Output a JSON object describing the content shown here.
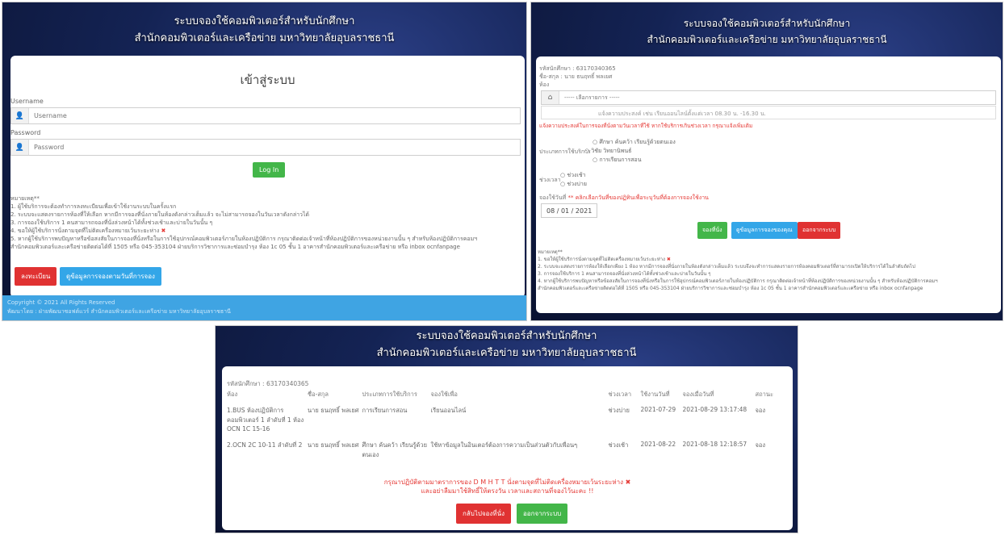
{
  "header": {
    "line1": "ระบบจองใช้คอมพิวเตอร์สำหรับนักศึกษา",
    "line2": "สำนักคอมพิวเตอร์และเครือข่าย มหาวิทยาลัยอุบลราชธานี"
  },
  "login": {
    "title": "เข้าสู่ระบบ",
    "username_label": "Username",
    "username_placeholder": "Username",
    "password_label": "Password",
    "password_placeholder": "Password",
    "login_button": "Log In",
    "notes_title": "หมายเหตุ**",
    "notes": [
      "1. ผู้ใช้บริการจะต้องทำการลงทะเบียนเพื่อเข้าใช้งานระบบในครั้งแรก",
      "2. ระบบจะแสดงรายการห้องที่ให้เลือก หากมีการจองที่นั่งภายในห้องดังกล่าวเต็มแล้ว จะไม่สามารถจองในวันเวลาดังกล่าวได้",
      "3. การจองใช้บริการ 1 คนสามารถจองที่นั่งล่วงหน้าได้ทั้งช่วงเช้าและบ่ายในวันนั้น ๆ",
      "4. ขอให้ผู้ใช้บริการนั่งตามจุดที่ไม่ติดเครื่องหมายเว้นระยะห่าง",
      "5. หากผู้ใช้บริการพบปัญหาหรือข้อสงสัยในการจองที่นั่งหรือในการใช้อุปกรณ์คอมพิวเตอร์ภายในห้องปฏิบัติการ กรุณาติดต่อเจ้าหน้าที่ห้องปฏิบัติการของหน่วยงานนั้น ๆ สำหรับห้องปฏิบัติการคอมฯ",
      "สำนักคอมพิวเตอร์และเครือข่ายติดต่อได้ที่ 1505 หรือ 045-353104 ฝ่ายบริการวิชาการและซ่อมบำรุง ห้อง 1c 05 ชั้น 1 อาคารสำนักคอมพิวเตอร์และเครือข่าย หรือ inbox ocnfanpage"
    ],
    "register_button": "ลงทะเบียน",
    "view_booking_button": "ดูข้อมูลการจองตามวันที่การจอง",
    "footer_copyright": "Copyright © 2021 All Rights Reserved",
    "footer_dev": "พัฒนาโดย : ฝ่ายพัฒนาซอฟต์แวร์ สำนักคอมพิวเตอร์และเครือข่าย มหาวิทยาลัยอุบลราชธานี"
  },
  "booking_form": {
    "student_id": "รหัสนักศึกษา : 63170340365",
    "name": "ชื่อ-สกุล : นาย ธนฤทธิ์ พลเยศ",
    "room_label": "ห้อง",
    "room_select": "----- เลือกรายการ -----",
    "purpose_placeholder": "แจ้งความประสงค์ เช่น เรียนออนไลน์ตั้งแต่เวลา 08.30 น. -16.30 น.",
    "purpose_warning": "แจ้งความประสงค์ในการจองที่นั่งตามวันเวลาที่ใช้ หากใช้บริการเกินช่วงเวลา กรุณาแจ้งเพิ่มเติม",
    "service_type_label": "ประเภทการใช้บริการ",
    "service_types": [
      "ศึกษา ค้นคว้า เรียนรู้ด้วยตนเอง",
      "วิชัย วิทยานิพนธ์",
      "การเรียนการสอน"
    ],
    "time_label": "ช่วงเวลา",
    "times": [
      "ช่วงเช้า",
      "ช่วงบ่าย"
    ],
    "date_label": "จองใช้วันที่",
    "date_hint": "** คลิกเลือกวันที่ของปฏิทินเพื่อระบุวันที่ต้องการจองใช้งาน",
    "date_value": "08 / 01 / 2021",
    "submit_button": "จองที่นั่ง",
    "my_booking_button": "ดูข้อมูลการจองของคุณ",
    "logout_button": "ออกจากระบบ",
    "notes_title": "หมายเหตุ**",
    "notes": [
      "1. ขอให้ผู้ใช้บริการนั่งตามจุดที่ไม่ติดเครื่องหมายเว้นระยะห่าง",
      "2. ระบบจะแสดงรายการห้องให้เลือกเพียง 1 ห้อง หากมีการจองที่นั่งภายในห้องดังกล่าวเต็มแล้ว ระบบจึงจะทำการแสดงรายการห้องคอมพิวเตอร์ที่สามารถเปิดให้บริการได้ในลำดับถัดไป",
      "3. การจองใช้บริการ 1 คนสามารถจองที่นั่งล่วงหน้าได้ทั้งช่วงเช้าและบ่ายในวันนั้น ๆ",
      "4. หากผู้ใช้บริการพบปัญหาหรือข้อสงสัยในการจองที่นั่งหรือในการใช้อุปกรณ์คอมพิวเตอร์ภายในห้องปฏิบัติการ กรุณาติดต่อเจ้าหน้าที่ห้องปฏิบัติการของหน่วยงานนั้น ๆ สำหรับห้องปฏิบัติการคอมฯ",
      "สำนักคอมพิวเตอร์และเครือข่ายติดต่อได้ที่ 1505 หรือ 045-353104 ฝ่ายบริการวิชาการและซ่อมบำรุง ห้อง 1c 05 ชั้น 1 อาคารสำนักคอมพิวเตอร์และเครือข่าย หรือ inbox ocnfanpage"
    ]
  },
  "booking_list": {
    "student_id": "รหัสนักศึกษา : 63170340365",
    "columns": [
      "ห้อง",
      "ชื่อ-สกุล",
      "ประเภทการใช้บริการ",
      "จองใช้เพื่อ",
      "ช่วงเวลา",
      "ใช้งานวันที่",
      "จองเมื่อวันที่",
      "สถานะ"
    ],
    "rows": [
      [
        "1.BUS ห้องปฏิบัติการคอมพิวเตอร์ 1 ลำดับที่ 1 ห้อง OCN 1C 15-16",
        "นาย ธนฤทธิ์ พลเยศ",
        "การเรียนการสอน",
        "เรียนออนไลน์",
        "ช่วงบ่าย",
        "2021-07-29",
        "2021-08-29 13:17:48",
        "จอง"
      ],
      [
        "2.OCN 2C 10-11 ลำดับที่ 2",
        "นาย ธนฤทธิ์ พลเยศ",
        "ศึกษา ค้นคว้า เรียนรู้ด้วยตนเอง",
        "ใช้หาข้อมูลในอินเตอร์ต้องการความเป็นส่วนตัวกับเพื่อนๆ",
        "ช่วงเช้า",
        "2021-08-22",
        "2021-08-18 12:18:57",
        "จอง"
      ]
    ],
    "warning_line1": "กรุณาปฏิบัติตามมาตราการของ D M H T T นั่งตามจุดที่ไม่ติดเครื่องหมายเว้นระยะห่าง",
    "warning_line2": "และอย่าลืมมาใช้สิทธิ์ให้ตรงวัน เวลาและสถานที่จองไว้นะคะ !!",
    "back_button": "กลับไปจองที่นั่ง",
    "logout_button": "ออกจากระบบ"
  }
}
